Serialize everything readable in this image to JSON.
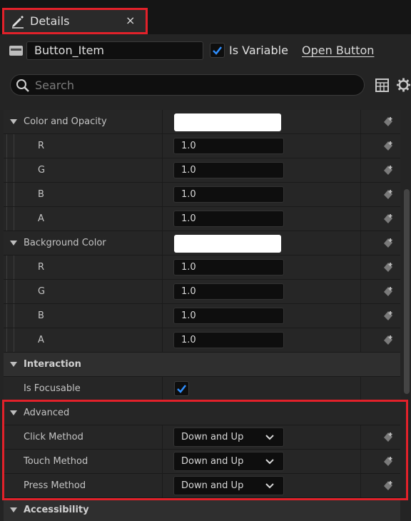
{
  "tab": {
    "title": "Details",
    "close": "×"
  },
  "header": {
    "name": "Button_Item",
    "is_variable_label": "Is Variable",
    "is_variable_checked": true,
    "open_label": "Open Button"
  },
  "search": {
    "placeholder": "Search"
  },
  "icons": {
    "tab": "pencil-icon",
    "widget": "widget-icon",
    "search": "search-icon",
    "table": "table-icon",
    "settings": "gear-icon",
    "reset": "reset-to-default-icon",
    "expand": "triangle-down-icon",
    "dropdown": "chevron-down-icon"
  },
  "rows": {
    "color_opacity": {
      "label": "Color and Opacity"
    },
    "co_r": {
      "label": "R",
      "value": "1.0"
    },
    "co_g": {
      "label": "G",
      "value": "1.0"
    },
    "co_b": {
      "label": "B",
      "value": "1.0"
    },
    "co_a": {
      "label": "A",
      "value": "1.0"
    },
    "background_color": {
      "label": "Background Color"
    },
    "bg_r": {
      "label": "R",
      "value": "1.0"
    },
    "bg_g": {
      "label": "G",
      "value": "1.0"
    },
    "bg_b": {
      "label": "B",
      "value": "1.0"
    },
    "bg_a": {
      "label": "A",
      "value": "1.0"
    },
    "interaction": {
      "label": "Interaction"
    },
    "is_focusable": {
      "label": "Is Focusable",
      "checked": true
    },
    "advanced": {
      "label": "Advanced"
    },
    "click_method": {
      "label": "Click Method",
      "value": "Down and Up"
    },
    "touch_method": {
      "label": "Touch Method",
      "value": "Down and Up"
    },
    "press_method": {
      "label": "Press Method",
      "value": "Down and Up"
    },
    "accessibility": {
      "label": "Accessibility"
    }
  },
  "colors": {
    "accent_check": "#2f8fff",
    "highlight": "#e2212a",
    "white_swatch": "#ffffff"
  }
}
